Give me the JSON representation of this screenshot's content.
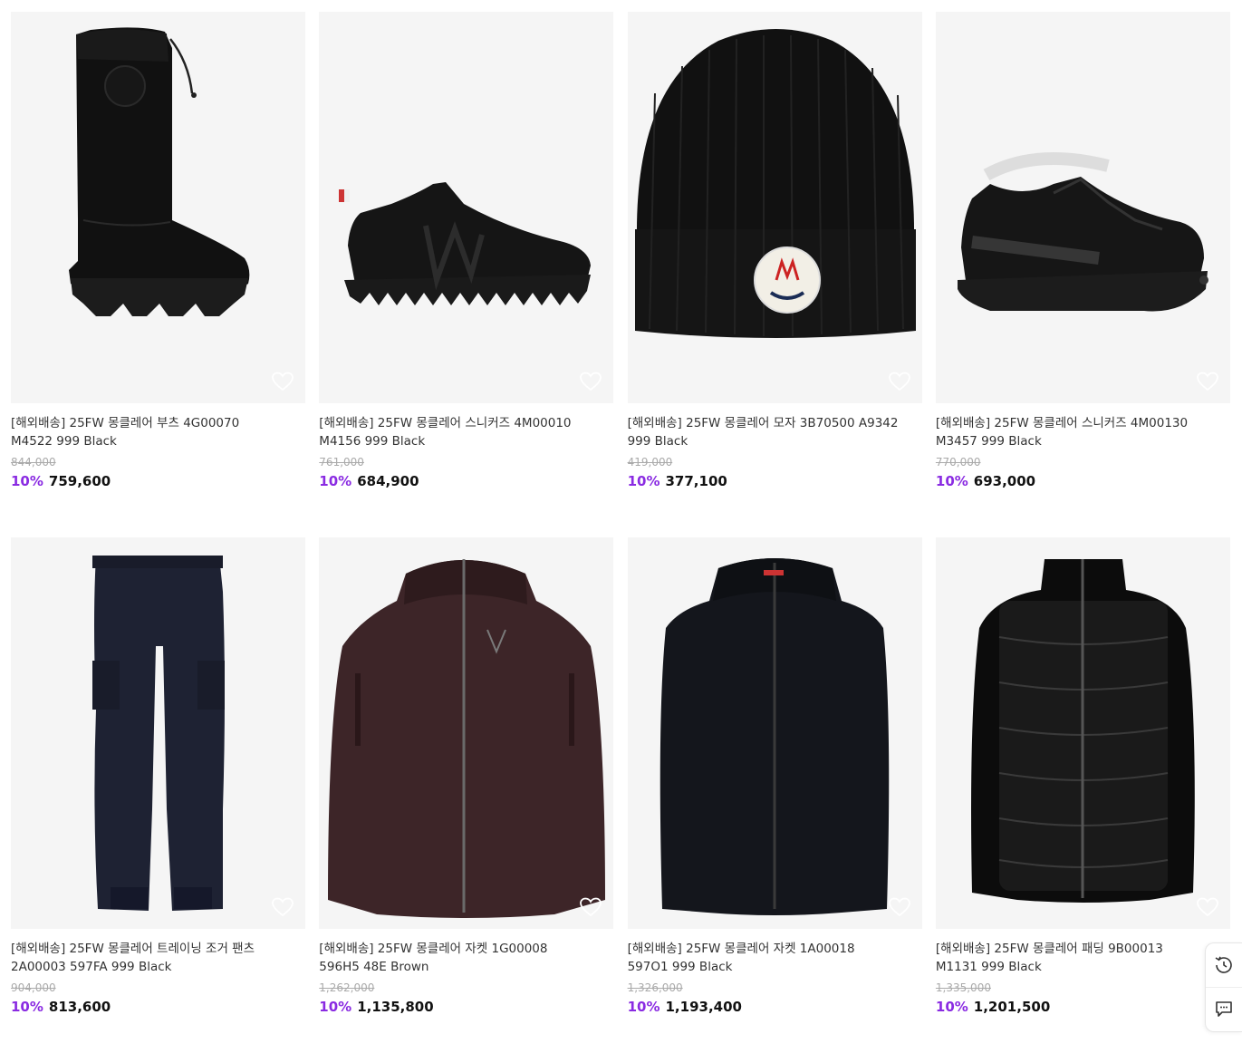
{
  "products": [
    {
      "name": "[해외배송] 25FW 몽클레어 부츠 4G00070 M4522 999 Black",
      "original_price": "844,000",
      "discount": "10%",
      "price": "759,600",
      "image_icon": "boot-image"
    },
    {
      "name": "[해외배송] 25FW 몽클레어 스니커즈 4M00010 M4156 999 Black",
      "original_price": "761,000",
      "discount": "10%",
      "price": "684,900",
      "image_icon": "sneaker-image"
    },
    {
      "name": "[해외배송] 25FW 몽클레어 모자 3B70500 A9342 999 Black",
      "original_price": "419,000",
      "discount": "10%",
      "price": "377,100",
      "image_icon": "beanie-image"
    },
    {
      "name": "[해외배송] 25FW 몽클레어 스니커즈 4M00130 M3457 999 Black",
      "original_price": "770,000",
      "discount": "10%",
      "price": "693,000",
      "image_icon": "sneaker-image"
    },
    {
      "name": "[해외배송] 25FW 몽클레어 트레이닝 조거 팬츠 2A00003 597FA 999 Black",
      "original_price": "904,000",
      "discount": "10%",
      "price": "813,600",
      "image_icon": "pants-image"
    },
    {
      "name": "[해외배송] 25FW 몽클레어 자켓 1G00008 596H5 48E Brown",
      "original_price": "1,262,000",
      "discount": "10%",
      "price": "1,135,800",
      "image_icon": "jacket-image"
    },
    {
      "name": "[해외배송] 25FW 몽클레어 자켓 1A00018 597O1 999 Black",
      "original_price": "1,326,000",
      "discount": "10%",
      "price": "1,193,400",
      "image_icon": "jacket-image"
    },
    {
      "name": "[해외배송] 25FW 몽클레어 패딩 9B00013 M1131 999 Black",
      "original_price": "1,335,000",
      "discount": "10%",
      "price": "1,201,500",
      "image_icon": "padding-jacket-image"
    }
  ],
  "colors": {
    "discount": "#8a2be2",
    "thumb_bg": "#f5f5f5",
    "strike": "#aaaaaa"
  },
  "floating": {
    "recent_icon": "history-icon",
    "chat_icon": "chat-icon"
  }
}
